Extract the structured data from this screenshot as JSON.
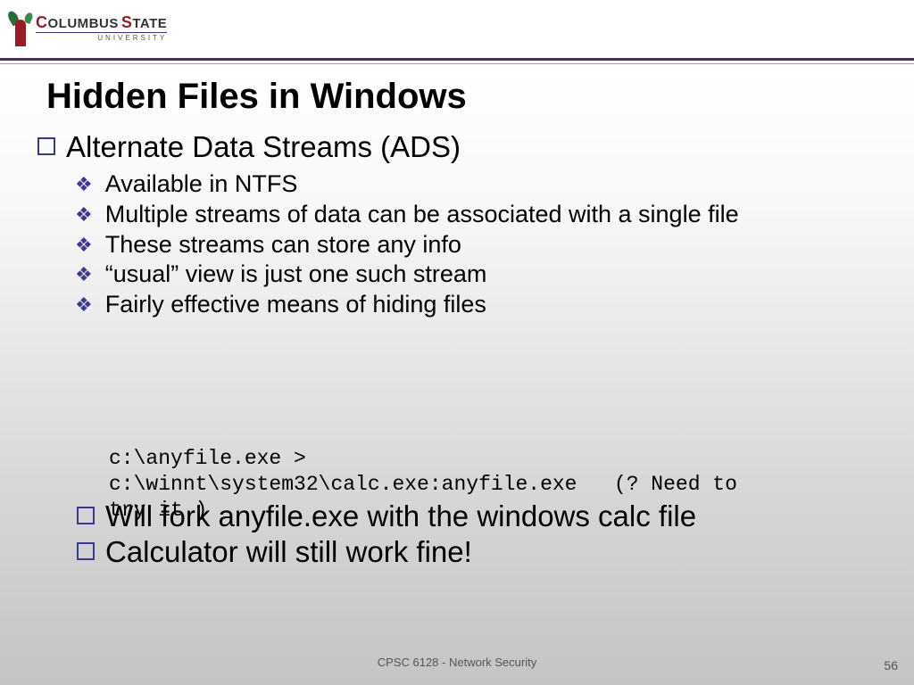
{
  "logo": {
    "line1a": "C",
    "line1b": "OLUMBUS",
    "line1c": "S",
    "line1d": "TATE",
    "line2": "UNIVERSITY"
  },
  "title": "Hidden Files in Windows",
  "main_bullet": "Alternate Data Streams (ADS)",
  "sub_bullets": [
    "Available in NTFS",
    "Multiple streams of data can be associated with a single file",
    "These streams can store any info",
    "“usual” view is just one such stream",
    "Fairly effective means of hiding files"
  ],
  "code": {
    "line1": "c:\\anyfile.exe >",
    "line2": "c:\\winnt\\system32\\calc.exe:anyfile.exe   (? Need to",
    "line3": "try it.)"
  },
  "overlay_bullets": [
    "Will fork anyfile.exe with the windows calc file",
    "Calculator will still work fine!"
  ],
  "footer": {
    "course": "CPSC 6128 - Network Security",
    "page": "56"
  }
}
